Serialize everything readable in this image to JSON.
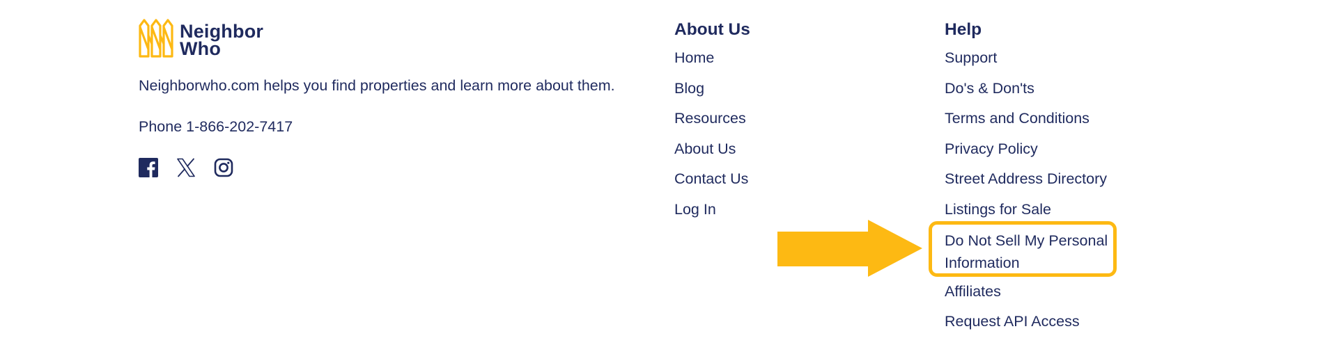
{
  "brand": {
    "logo_line1": "Neighbor",
    "logo_line2": "Who",
    "logo_icon": "fence-logo-icon",
    "accent_color": "#fdb913",
    "text_color": "#1f2a5e"
  },
  "about": {
    "description": "Neighborwho.com helps you find properties and learn more about them.",
    "phone": "Phone 1-866-202-7417"
  },
  "social": [
    {
      "name": "facebook",
      "icon": "facebook-icon"
    },
    {
      "name": "x",
      "icon": "x-icon"
    },
    {
      "name": "instagram",
      "icon": "instagram-icon"
    }
  ],
  "columns": {
    "about_us": {
      "heading": "About Us",
      "links": [
        "Home",
        "Blog",
        "Resources",
        "About Us",
        "Contact Us",
        "Log In"
      ]
    },
    "help": {
      "heading": "Help",
      "links": [
        "Support",
        "Do's & Don'ts",
        "Terms and Conditions",
        "Privacy Policy",
        "Street Address Directory",
        "Listings for Sale",
        "Do Not Sell My Personal Information",
        "Affiliates",
        "Request API Access"
      ]
    }
  },
  "annotation": {
    "type": "arrow-and-box",
    "target": "Do Not Sell My Personal Information",
    "color": "#fdb913"
  }
}
